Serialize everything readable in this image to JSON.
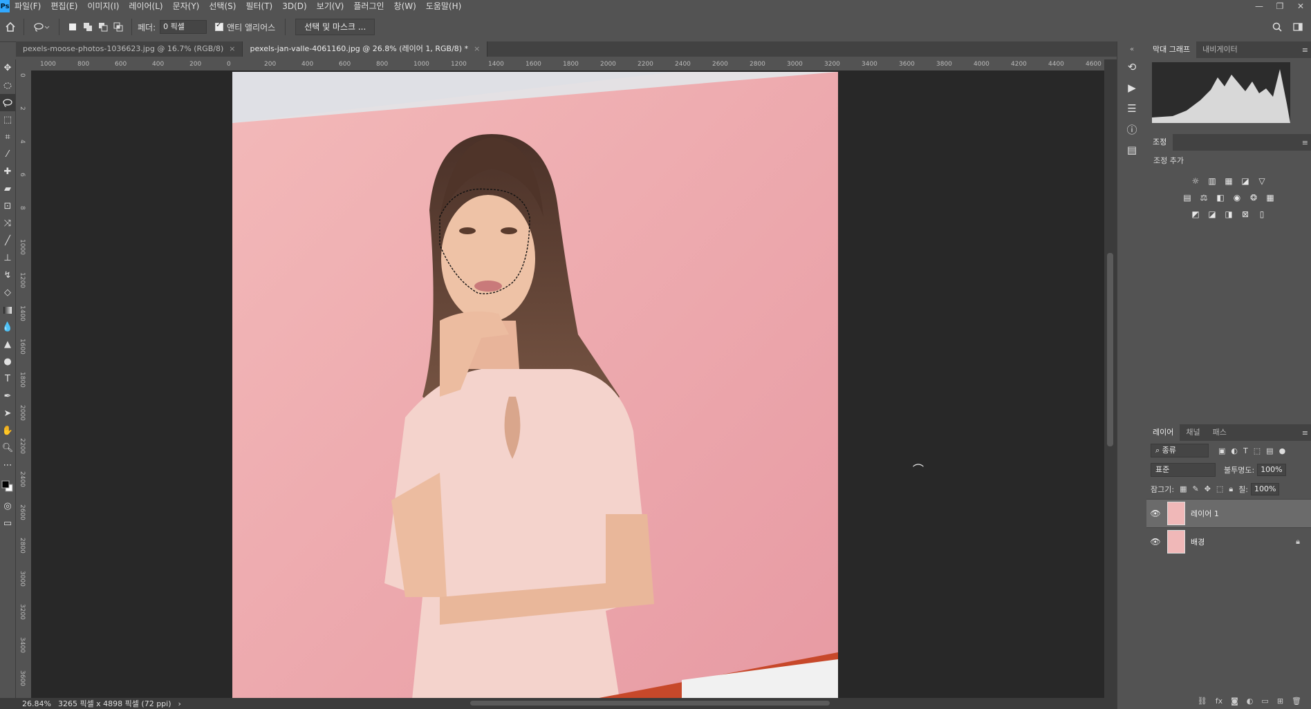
{
  "menu": [
    "파일(F)",
    "편집(E)",
    "이미지(I)",
    "레이어(L)",
    "문자(Y)",
    "선택(S)",
    "필터(T)",
    "3D(D)",
    "보기(V)",
    "플러그인",
    "창(W)",
    "도움말(H)"
  ],
  "app_logo": "Ps",
  "window_controls": [
    "—",
    "❐",
    "✕"
  ],
  "options": {
    "feather_label": "페더:",
    "feather_value": "0 픽셀",
    "antialias_label": "앤티 앨리어스",
    "select_mask_button": "선택 및 마스크 ..."
  },
  "tabs": [
    {
      "label": "pexels-moose-photos-1036623.jpg @ 16.7% (RGB/8)",
      "close": "×"
    },
    {
      "label": "pexels-jan-valle-4061160.jpg @ 26.8% (레이어 1, RGB/8) *",
      "close": "×"
    }
  ],
  "ruler_h_ticks": [
    "1000",
    "800",
    "600",
    "400",
    "200",
    "0",
    "200",
    "400",
    "600",
    "800",
    "1000",
    "1200",
    "1400",
    "1600",
    "1800",
    "2000",
    "2200",
    "2400",
    "2600",
    "2800",
    "3000",
    "3200",
    "3400",
    "3600",
    "3800",
    "4000",
    "4200",
    "4400",
    "4600"
  ],
  "ruler_v_ticks": [
    "0",
    "2",
    "4",
    "6",
    "8",
    "1000",
    "1200",
    "1400",
    "1600",
    "1800",
    "2000",
    "2200",
    "2400",
    "2600",
    "2800",
    "3000",
    "3200",
    "3400",
    "3600"
  ],
  "status": {
    "zoom": "26.84%",
    "dimensions": "3265 픽셀 x 4898 픽셀 (72 ppi)",
    "arrow": "›"
  },
  "histogram_panel": {
    "tabs": [
      "막대 그래프",
      "내비게이터"
    ],
    "menu": "≡"
  },
  "adjustments_panel": {
    "tab": "조정",
    "title": "조정 추가",
    "menu": "≡"
  },
  "layers_panel": {
    "tabs": [
      "레이어",
      "채널",
      "패스"
    ],
    "menu": "≡",
    "filter_kind": "종류",
    "blend_mode": "표준",
    "opacity_label": "불투명도:",
    "opacity_value": "100%",
    "lock_label": "잠그기:",
    "fill_label": "칠:",
    "fill_value": "100%",
    "layers": [
      {
        "name": "레이어 1",
        "selected": true,
        "locked": false
      },
      {
        "name": "배경",
        "selected": false,
        "locked": true
      }
    ],
    "footer_icons": [
      "link-icon",
      "fx-icon",
      "mask-icon",
      "adjustment-icon",
      "group-icon",
      "new-layer-icon",
      "delete-icon"
    ]
  },
  "colors": {
    "app_bg": "#535353",
    "canvas_bg": "#282828",
    "photo_bg": "#f0b8b8"
  }
}
